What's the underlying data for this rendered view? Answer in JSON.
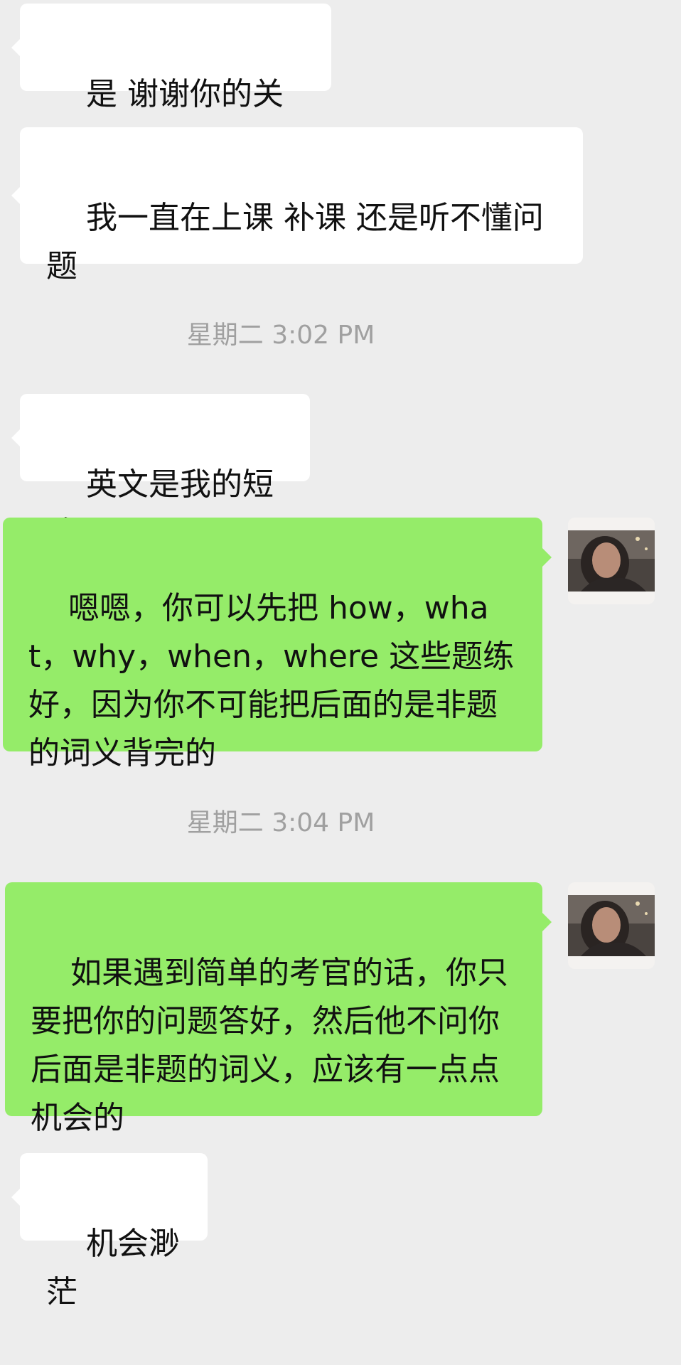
{
  "chat": {
    "messages": [
      {
        "sender": "other",
        "text": "是 谢谢你的关心"
      },
      {
        "sender": "other",
        "text": "我一直在上课 补课 还是听不懂问题"
      },
      {
        "sender": "other",
        "text": "英文是我的短路"
      },
      {
        "sender": "self",
        "text": "嗯嗯，你可以先把 how，what，why，when，where 这些题练好，因为你不可能把后面的是非题的词义背完的"
      },
      {
        "sender": "self",
        "text": "如果遇到简单的考官的话，你只要把你的问题答好，然后他不问你后面是非题的词义，应该有一点点机会的"
      },
      {
        "sender": "other",
        "text": "机会渺茫"
      }
    ],
    "timestamps": [
      "星期二 3:02 PM",
      "星期二 3:04 PM"
    ]
  },
  "colors": {
    "background": "#ededed",
    "incoming_bubble": "#ffffff",
    "outgoing_bubble": "#95ec69",
    "timestamp_text": "#a0a0a0"
  },
  "icons": {
    "self_avatar": "user-avatar-photo"
  }
}
